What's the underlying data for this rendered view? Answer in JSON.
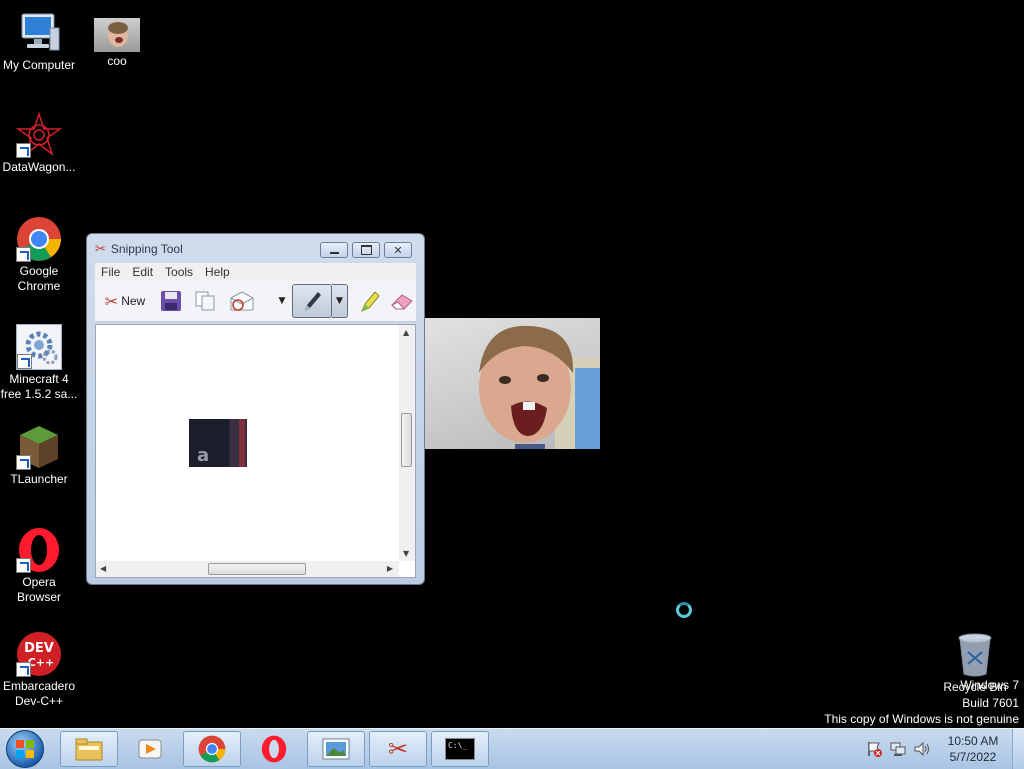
{
  "desktop": {
    "icons": [
      {
        "label": "My Computer"
      },
      {
        "label": "coo"
      },
      {
        "label": "DataWagon..."
      },
      {
        "label": "Google Chrome"
      },
      {
        "label": "Minecraft 4 free 1.5.2 sa..."
      },
      {
        "label": "TLauncher"
      },
      {
        "label": "Opera Browser"
      },
      {
        "label": "Embarcadero Dev-C++"
      },
      {
        "label": "Recycle Bin"
      }
    ]
  },
  "snipping_tool": {
    "title": "Snipping Tool",
    "menu": [
      "File",
      "Edit",
      "Tools",
      "Help"
    ],
    "new_label": "New"
  },
  "watermark": {
    "line1": "Windows 7",
    "line2": "Build 7601",
    "line3": "This copy of Windows is not genuine"
  },
  "tray": {
    "time": "10:50 AM",
    "date": "5/7/2022"
  },
  "dev_icon_text": "DEV",
  "dev_icon_sub": "C++",
  "cmd_icon_text": "C:\\_",
  "canvas_letter": "a"
}
